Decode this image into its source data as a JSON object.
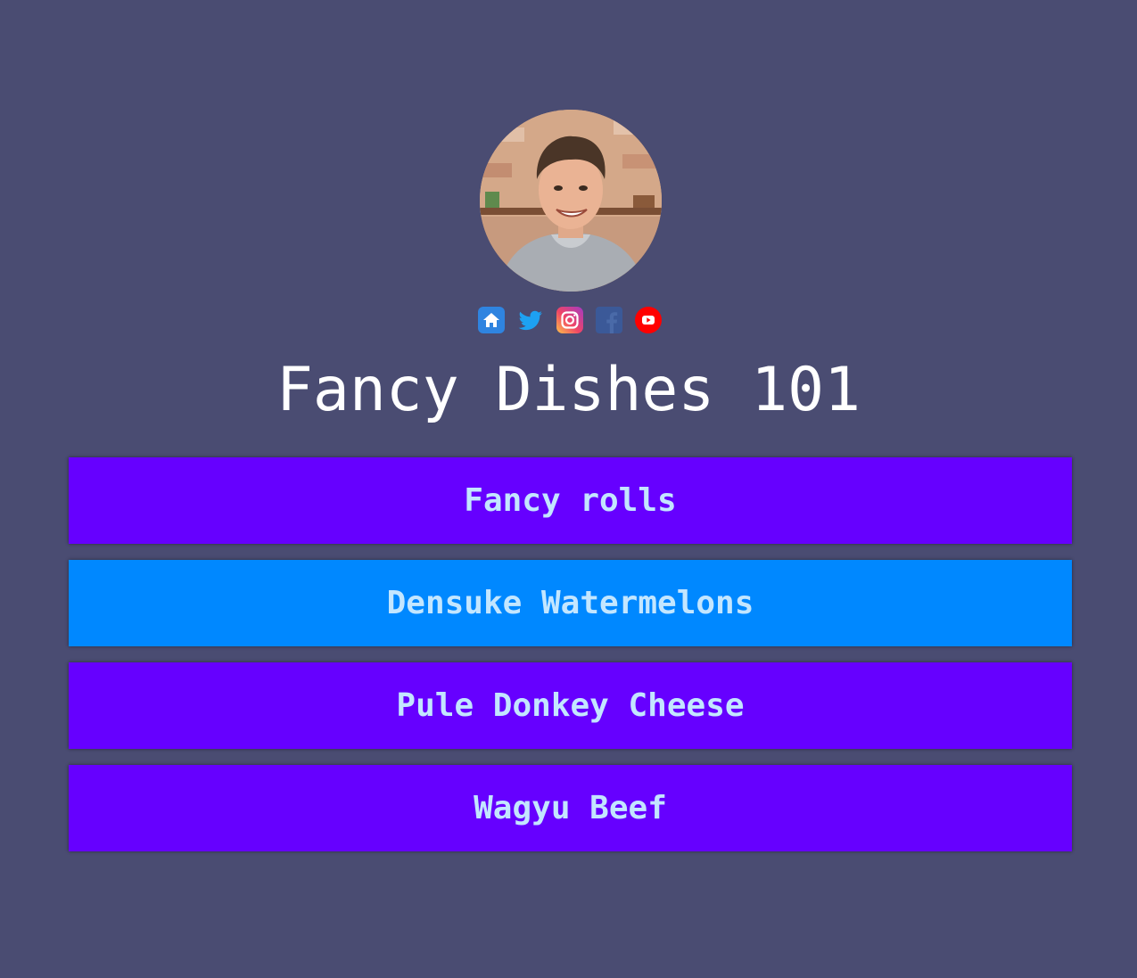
{
  "profile": {
    "avatar_alt": "profile photo"
  },
  "socials": [
    {
      "icon": "home-icon",
      "color": "#2f84e0"
    },
    {
      "icon": "twitter-icon",
      "color": "#1da1f2"
    },
    {
      "icon": "instagram-icon",
      "color": "#e1306c"
    },
    {
      "icon": "facebook-icon",
      "color": "#3b5998"
    },
    {
      "icon": "youtube-icon",
      "color": "#ff0000"
    }
  ],
  "title": "Fancy Dishes 101",
  "links": [
    {
      "label": "Fancy rolls"
    },
    {
      "label": "Densuke Watermelons"
    },
    {
      "label": "Pule Donkey Cheese"
    },
    {
      "label": "Wagyu Beef"
    }
  ],
  "colors": {
    "background": "#4a4c72",
    "button": "#6600ff",
    "button_active": "#0088ff",
    "button_text": "#c3e6ff",
    "title": "#ffffff"
  }
}
